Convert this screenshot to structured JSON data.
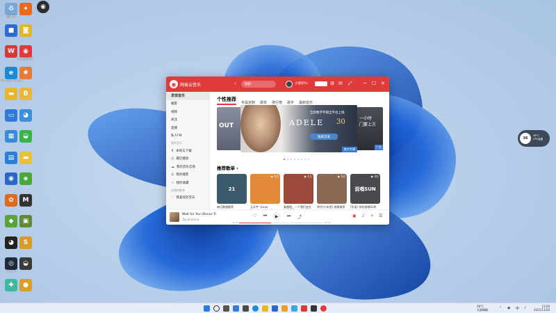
{
  "desktop": {
    "icons_col1": [
      {
        "label": "回收站",
        "color": "#7aa6d8",
        "glyph": "♻"
      },
      {
        "label": "",
        "color": "#2c6bd1",
        "glyph": "■"
      },
      {
        "label": "",
        "color": "#d83a3a",
        "glyph": "W"
      },
      {
        "label": "Microsoft Edge",
        "color": "#1b8bd6",
        "glyph": "e"
      },
      {
        "label": "",
        "color": "#e8b628",
        "glyph": "▬"
      },
      {
        "label": "",
        "color": "#2f7bd6",
        "glyph": "▭"
      },
      {
        "label": "",
        "color": "#3a8bd8",
        "glyph": "▦"
      },
      {
        "label": "",
        "color": "#2b7ed6",
        "glyph": "▤"
      },
      {
        "label": "",
        "color": "#2b68c6",
        "glyph": "◉"
      },
      {
        "label": "",
        "color": "#e06a1e",
        "glyph": "✿"
      },
      {
        "label": "",
        "color": "#58a33a",
        "glyph": "◆"
      },
      {
        "label": "",
        "color": "#222222",
        "glyph": "◕"
      },
      {
        "label": "Steam",
        "color": "#1e2a3a",
        "glyph": "◎"
      },
      {
        "label": "",
        "color": "#3fb8a0",
        "glyph": "✚"
      }
    ],
    "icons_col2": [
      {
        "label": "",
        "color": "#e86a1a",
        "glyph": "✦"
      },
      {
        "label": "",
        "color": "#e2b52a",
        "glyph": "◙"
      },
      {
        "label": "网易云音乐",
        "color": "#e03b3b",
        "glyph": "◉"
      },
      {
        "label": "",
        "color": "#e57a3a",
        "glyph": "✸"
      },
      {
        "label": "",
        "color": "#eab53a",
        "glyph": "B"
      },
      {
        "label": "",
        "color": "#3a8fd8",
        "glyph": "◕"
      },
      {
        "label": "",
        "color": "#3cb24a",
        "glyph": "◒"
      },
      {
        "label": "",
        "color": "#e8c03a",
        "glyph": "▬"
      },
      {
        "label": "",
        "color": "#4aa83a",
        "glyph": "◈"
      },
      {
        "label": "",
        "color": "#333333",
        "glyph": "M"
      },
      {
        "label": "",
        "color": "#5f8a3a",
        "glyph": "▣"
      },
      {
        "label": "",
        "color": "#d89a2a",
        "glyph": "S"
      },
      {
        "label": "",
        "color": "#3a3a3a",
        "glyph": "◒"
      },
      {
        "label": "",
        "color": "#d8a02a",
        "glyph": "●"
      }
    ],
    "top_icon": {
      "label": "",
      "color": "#2c2c2c",
      "glyph": "◉"
    }
  },
  "app": {
    "title": "网易云音乐",
    "back_glyph": "‹",
    "search_placeholder": "搜索",
    "username": "小黑的Yu",
    "titlebar_icons": [
      "⚙",
      "✉",
      "⤢",
      "─",
      "☐",
      "✕"
    ],
    "sidebar": [
      {
        "label": "发现音乐",
        "active": true,
        "icon": ""
      },
      {
        "label": "播客",
        "active": false,
        "icon": ""
      },
      {
        "label": "视频",
        "active": false,
        "icon": ""
      },
      {
        "label": "关注",
        "active": false,
        "icon": ""
      },
      {
        "label": "直播",
        "active": false,
        "icon": ""
      },
      {
        "label": "私人FM",
        "active": false,
        "icon": ""
      }
    ],
    "sidebar_section_mine": "我的音乐",
    "sidebar_mine": [
      {
        "label": "本地与下载",
        "icon": "⬇"
      },
      {
        "label": "最近播放",
        "icon": "◷"
      },
      {
        "label": "我的音乐云盘",
        "icon": "☁"
      },
      {
        "label": "我的播客",
        "icon": "◎"
      },
      {
        "label": "我的收藏",
        "icon": "☆"
      }
    ],
    "sidebar_section_created": "创建的歌单",
    "sidebar_created": [
      {
        "label": "我喜欢的音乐",
        "icon": "♡"
      }
    ],
    "tabs": [
      {
        "label": "个性推荐",
        "active": true
      },
      {
        "label": "专属定制",
        "active": false
      },
      {
        "label": "歌单",
        "active": false
      },
      {
        "label": "排行榜",
        "active": false
      },
      {
        "label": "歌手",
        "active": false
      },
      {
        "label": "最新音乐",
        "active": false
      }
    ],
    "banner": {
      "left_text": "OUT",
      "subtitle": "全新数字专辑全平台上线",
      "title": "ADELE",
      "number": "30",
      "button": "独家首发",
      "tag": "数字专辑",
      "right_line1": "一小时",
      "right_line2": "门蒙上方",
      "right_tag": "广告"
    },
    "section_title": "推荐歌单 ›",
    "cards": [
      {
        "title": "每日歌曲推荐",
        "count": "",
        "color": "#3c5a6c",
        "glyph": "21"
      },
      {
        "title": "马天宇《Love Someone Like Me》专辑",
        "count": "▶ 1亿",
        "color": "#e28a3a",
        "glyph": ""
      },
      {
        "title": "真唱吧，一个我们会在这里相遇",
        "count": "▶ 1万",
        "color": "#9b4a3a",
        "glyph": ""
      },
      {
        "title": "[时代少年团] 热歌推荐",
        "count": "▶ 1亿",
        "color": "#8a6a54",
        "glyph": ""
      },
      {
        "title": "[华语] 你的说唱SUN",
        "count": "▶ 2亿",
        "color": "#4a4a4e",
        "glyph": "说唱SUN"
      }
    ],
    "player": {
      "song": "Wait for You (Bonus Tr",
      "artist": "Tay Jastrone",
      "time_current": "00:00",
      "time_total": "03:25",
      "progress": 0.38
    }
  },
  "widget": {
    "value": "36",
    "line1": "46°C",
    "line2": "CPU温度"
  },
  "taskbar": {
    "weather_line1": "28°C",
    "weather_line2": "大部晴朗",
    "time": "13:00",
    "date": "2021/11/20"
  }
}
